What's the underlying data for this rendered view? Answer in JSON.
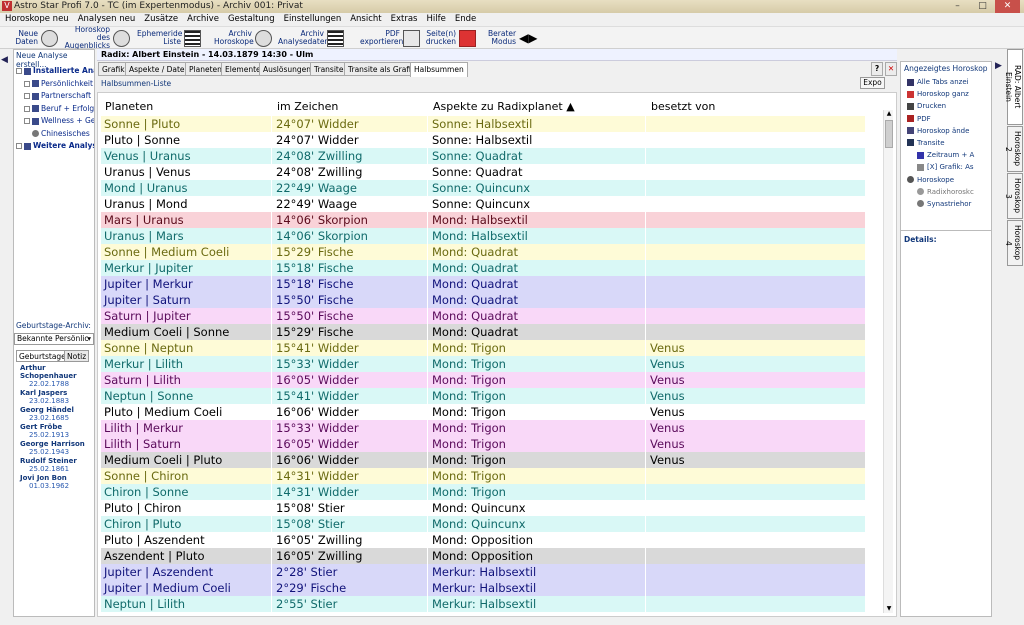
{
  "window": {
    "title": "Astro Star Profi 7.0 - TC (im Expertenmodus) - Archiv 001: Privat",
    "min": "–",
    "max": "□",
    "close": "✕"
  },
  "menu": [
    "Horoskope neu",
    "Analysen neu",
    "Zusätze",
    "Archive",
    "Gestaltung",
    "Einstellungen",
    "Ansicht",
    "Extras",
    "Hilfe",
    "Ende"
  ],
  "toolbar": {
    "neue_daten": "Neue Daten",
    "horoskop_augenblicks": "Horoskop des Augenblicks",
    "ephemeride": "Ephemeride Liste",
    "archiv_horoskope": "Archiv Horoskope",
    "archiv_analysedaten": "Archiv Analysedaten",
    "pdf": "PDF exportieren",
    "drucken": "Seite(n) drucken",
    "berater": "Berater Modus"
  },
  "left": {
    "title": "Neue Analyse erstell...",
    "tree": [
      "Installierte Ana",
      "Persönlichkeit",
      "Partnerschaft",
      "Beruf + Erfolg",
      "Wellness + Ge",
      "Chinesisches",
      "Weitere Analys"
    ],
    "archive_label": "Geburtstage-Archiv:",
    "archive_select": "Bekannte Persönlic",
    "tab_bdays": "Geburtstage",
    "tab_notiz": "Notiz",
    "birthdays": [
      {
        "name": "Arthur Schopenhauer",
        "date": "22.02.1788"
      },
      {
        "name": "Karl Jaspers",
        "date": "23.02.1883"
      },
      {
        "name": "Georg Händel",
        "date": "23.02.1685"
      },
      {
        "name": "Gert Fröbe",
        "date": "25.02.1913"
      },
      {
        "name": "George Harrison",
        "date": "25.02.1943"
      },
      {
        "name": "Rudolf Steiner",
        "date": "25.02.1861"
      },
      {
        "name": "Jovi Jon Bon",
        "date": "01.03.1962"
      }
    ]
  },
  "main": {
    "header": "Radix: Albert Einstein - 14.03.1879 14:30 - Ulm",
    "tabs": [
      "Grafik",
      "Aspekte / Daten",
      "Planeten",
      "Elemente",
      "Auslösungen",
      "Transite",
      "Transite als Grafik",
      "Halbsummen"
    ],
    "active_tab": "Halbsummen",
    "sublabel": "Halbsummen-Liste",
    "expo": "Expo",
    "help": "?",
    "close": "✕",
    "columns": [
      "Planeten",
      "im Zeichen",
      "Aspekte zu Radixplanet ▲",
      "besetzt von"
    ],
    "rows": [
      {
        "c": "yellow",
        "p": "Sonne | Pluto",
        "z": "24°07' Widder",
        "a": "Sonne: Halbsextil",
        "b": ""
      },
      {
        "c": "white",
        "p": "Pluto | Sonne",
        "z": "24°07' Widder",
        "a": "Sonne: Halbsextil",
        "b": ""
      },
      {
        "c": "cyan",
        "p": "Venus | Uranus",
        "z": "24°08' Zwilling",
        "a": "Sonne: Quadrat",
        "b": ""
      },
      {
        "c": "white",
        "p": "Uranus | Venus",
        "z": "24°08' Zwilling",
        "a": "Sonne: Quadrat",
        "b": ""
      },
      {
        "c": "cyan",
        "p": "Mond | Uranus",
        "z": "22°49' Waage",
        "a": "Sonne: Quincunx",
        "b": ""
      },
      {
        "c": "white",
        "p": "Uranus | Mond",
        "z": "22°49' Waage",
        "a": "Sonne: Quincunx",
        "b": ""
      },
      {
        "c": "red",
        "p": "Mars | Uranus",
        "z": "14°06' Skorpion",
        "a": "Mond: Halbsextil",
        "b": ""
      },
      {
        "c": "cyan",
        "p": "Uranus | Mars",
        "z": "14°06' Skorpion",
        "a": "Mond: Halbsextil",
        "b": ""
      },
      {
        "c": "yellow",
        "p": "Sonne | Medium Coeli",
        "z": "15°29' Fische",
        "a": "Mond: Quadrat",
        "b": ""
      },
      {
        "c": "cyan",
        "p": "Merkur | Jupiter",
        "z": "15°18' Fische",
        "a": "Mond: Quadrat",
        "b": ""
      },
      {
        "c": "blue",
        "p": "Jupiter | Merkur",
        "z": "15°18' Fische",
        "a": "Mond: Quadrat",
        "b": ""
      },
      {
        "c": "blue",
        "p": "Jupiter | Saturn",
        "z": "15°50' Fische",
        "a": "Mond: Quadrat",
        "b": ""
      },
      {
        "c": "pink",
        "p": "Saturn | Jupiter",
        "z": "15°50' Fische",
        "a": "Mond: Quadrat",
        "b": ""
      },
      {
        "c": "gray",
        "p": "Medium Coeli | Sonne",
        "z": "15°29' Fische",
        "a": "Mond: Quadrat",
        "b": ""
      },
      {
        "c": "yellow",
        "p": "Sonne | Neptun",
        "z": "15°41' Widder",
        "a": "Mond: Trigon",
        "b": "Venus"
      },
      {
        "c": "cyan",
        "p": "Merkur | Lilith",
        "z": "15°33' Widder",
        "a": "Mond: Trigon",
        "b": "Venus"
      },
      {
        "c": "pink",
        "p": "Saturn | Lilith",
        "z": "16°05' Widder",
        "a": "Mond: Trigon",
        "b": "Venus"
      },
      {
        "c": "cyan",
        "p": "Neptun | Sonne",
        "z": "15°41' Widder",
        "a": "Mond: Trigon",
        "b": "Venus"
      },
      {
        "c": "white",
        "p": "Pluto | Medium Coeli",
        "z": "16°06' Widder",
        "a": "Mond: Trigon",
        "b": "Venus"
      },
      {
        "c": "pink",
        "p": "Lilith | Merkur",
        "z": "15°33' Widder",
        "a": "Mond: Trigon",
        "b": "Venus"
      },
      {
        "c": "pink",
        "p": "Lilith | Saturn",
        "z": "16°05' Widder",
        "a": "Mond: Trigon",
        "b": "Venus"
      },
      {
        "c": "gray",
        "p": "Medium Coeli | Pluto",
        "z": "16°06' Widder",
        "a": "Mond: Trigon",
        "b": "Venus"
      },
      {
        "c": "yellow",
        "p": "Sonne | Chiron",
        "z": "14°31' Widder",
        "a": "Mond: Trigon",
        "b": ""
      },
      {
        "c": "cyan",
        "p": "Chiron | Sonne",
        "z": "14°31' Widder",
        "a": "Mond: Trigon",
        "b": ""
      },
      {
        "c": "white",
        "p": "Pluto | Chiron",
        "z": "15°08' Stier",
        "a": "Mond: Quincunx",
        "b": ""
      },
      {
        "c": "cyan",
        "p": "Chiron | Pluto",
        "z": "15°08' Stier",
        "a": "Mond: Quincunx",
        "b": ""
      },
      {
        "c": "white",
        "p": "Pluto | Aszendent",
        "z": "16°05' Zwilling",
        "a": "Mond: Opposition",
        "b": ""
      },
      {
        "c": "gray",
        "p": "Aszendent | Pluto",
        "z": "16°05' Zwilling",
        "a": "Mond: Opposition",
        "b": ""
      },
      {
        "c": "blue",
        "p": "Jupiter | Aszendent",
        "z": "2°28' Stier",
        "a": "Merkur: Halbsextil",
        "b": ""
      },
      {
        "c": "blue",
        "p": "Jupiter | Medium Coeli",
        "z": "2°29' Fische",
        "a": "Merkur: Halbsextil",
        "b": ""
      },
      {
        "c": "cyan",
        "p": "Neptun | Lilith",
        "z": "2°55' Stier",
        "a": "Merkur: Halbsextil",
        "b": ""
      }
    ]
  },
  "right": {
    "title": "Angezeigtes Horoskop",
    "items": [
      "Alle Tabs anzei",
      "Horoskop ganz",
      "Drucken",
      "PDF",
      "Horoskop ände",
      "Transite",
      "Zeitraum + A",
      "[X] Grafik: As",
      "Horoskope",
      "Radixhoroskc",
      "Synastriehor"
    ],
    "details": "Details:"
  },
  "vtabs": [
    "RAD: Albert Einstein",
    "Horoskop 2",
    "Horoskop 3",
    "Horoskop 4"
  ]
}
